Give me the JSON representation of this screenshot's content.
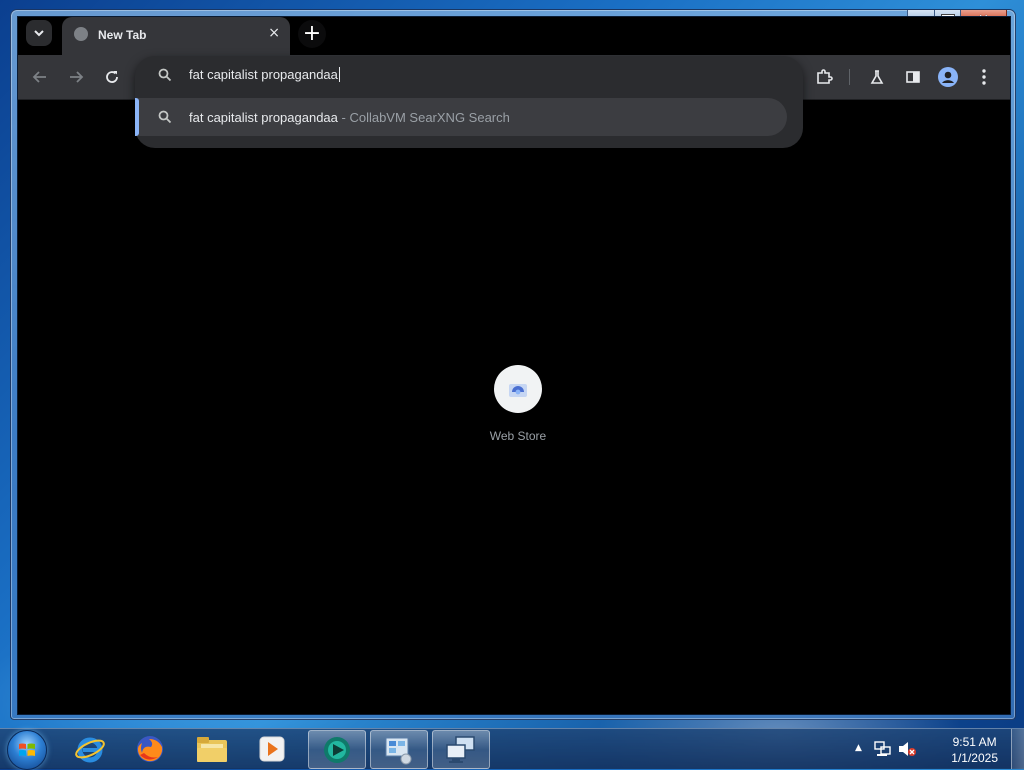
{
  "browser": {
    "tab": {
      "title": "New Tab",
      "close_glyph": "×"
    },
    "new_tab_glyph": "+",
    "omnibox": {
      "query": "fat capitalist propagandaa",
      "suggestion": {
        "query": "fat capitalist propagandaa",
        "separator": " - ",
        "provider": "CollabVM SearXNG Search"
      }
    },
    "accent_color": "#8ab4f8",
    "toolbar_icons": [
      "back-icon",
      "forward-icon",
      "reload-icon",
      "extensions-icon",
      "labs-icon",
      "side-panel-icon",
      "profile-icon",
      "menu-icon"
    ]
  },
  "ntp": {
    "shortcut": {
      "label": "Web Store"
    }
  },
  "window": {
    "caption": {
      "min": "min",
      "max": "max",
      "close": "×"
    }
  },
  "taskbar": {
    "apps": [
      "internet-explorer-icon",
      "firefox-icon",
      "file-explorer-icon",
      "media-player-icon",
      "chrome-icon",
      "control-panel-icon",
      "remote-desktop-icon"
    ],
    "clock": {
      "time": "9:51 AM",
      "date": "1/1/2025"
    }
  }
}
